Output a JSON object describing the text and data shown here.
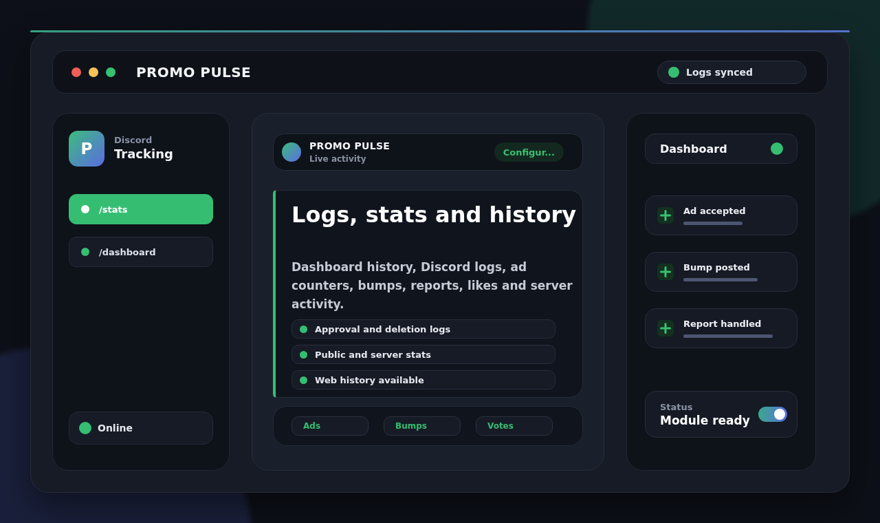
{
  "window": {
    "title": "PROMO PULSE",
    "controls": [
      {
        "color": "#ee5f57"
      },
      {
        "color": "#f4c15a"
      },
      {
        "color": "#35c172"
      }
    ]
  },
  "sync_badge": {
    "label": "Logs synced"
  },
  "sidebar": {
    "logo_letter": "P",
    "subtitle": "Discord",
    "title": "Tracking",
    "items": [
      {
        "label": "/stats",
        "selected": true
      },
      {
        "label": "/dashboard",
        "selected": false
      }
    ],
    "status": {
      "label": "Online"
    }
  },
  "feed": {
    "header": {
      "title": "PROMO PULSE",
      "subtitle": "Live activity",
      "button": "Configur..."
    },
    "heading": "Logs, stats and history",
    "description": "Dashboard history, Discord logs, ad counters, bumps, reports, likes and server activity.",
    "features": [
      "Approval and deletion logs",
      "Public and server stats",
      "Web history available"
    ],
    "tags": [
      "Ads",
      "Bumps",
      "Votes"
    ]
  },
  "right_panel": {
    "title": "Dashboard",
    "events": [
      {
        "label": "Ad accepted"
      },
      {
        "label": "Bump posted"
      },
      {
        "label": "Report handled"
      }
    ],
    "status": {
      "label": "Status",
      "value": "Module ready",
      "on": true
    }
  }
}
